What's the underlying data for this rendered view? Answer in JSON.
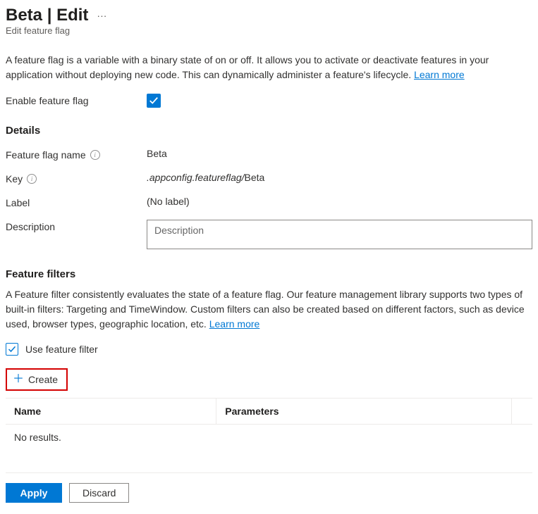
{
  "header": {
    "title": "Beta | Edit",
    "subtitle": "Edit feature flag"
  },
  "intro": {
    "text": "A feature flag is a variable with a binary state of on or off. It allows you to activate or deactivate features in your application without deploying new code. This can dynamically administer a feature's lifecycle. ",
    "learn_more": "Learn more"
  },
  "enable": {
    "label": "Enable feature flag",
    "checked": true
  },
  "details": {
    "heading": "Details",
    "name_label": "Feature flag name",
    "name_value": "Beta",
    "key_label": "Key",
    "key_prefix": ".appconfig.featureflag/",
    "key_name": "Beta",
    "label_label": "Label",
    "label_value": "(No label)",
    "description_label": "Description",
    "description_placeholder": "Description",
    "description_value": ""
  },
  "filters": {
    "heading": "Feature filters",
    "text": "A Feature filter consistently evaluates the state of a feature flag. Our feature management library supports two types of built-in filters: Targeting and TimeWindow. Custom filters can also be created based on different factors, such as device used, browser types, geographic location, etc. ",
    "learn_more": "Learn more",
    "use_filter_label": "Use feature filter",
    "use_filter_checked": true,
    "create_label": "Create",
    "table": {
      "col_name": "Name",
      "col_params": "Parameters",
      "empty": "No results."
    }
  },
  "footer": {
    "apply": "Apply",
    "discard": "Discard"
  }
}
